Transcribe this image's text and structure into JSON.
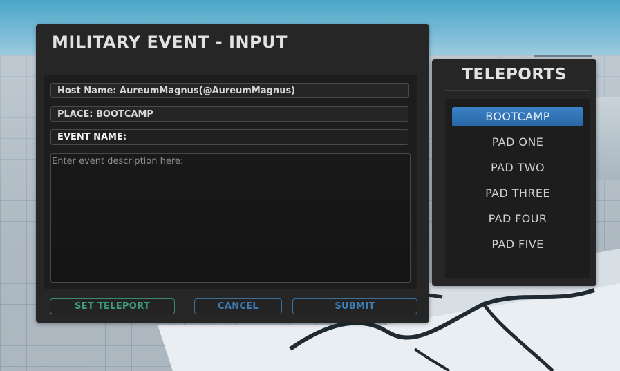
{
  "main_panel": {
    "title": "MILITARY EVENT - INPUT",
    "host_name": "Host Name: AureumMagnus(@AureumMagnus)",
    "place": "PLACE: BOOTCAMP",
    "event_name": "EVENT NAME:",
    "description_placeholder": "Enter event description here:",
    "buttons": {
      "set_teleport": "SET TELEPORT",
      "cancel": "CANCEL",
      "submit": "SUBMIT"
    }
  },
  "teleports": {
    "title": "TELEPORTS",
    "selected": "BOOTCAMP",
    "items": [
      {
        "label": "BOOTCAMP"
      },
      {
        "label": "PAD ONE"
      },
      {
        "label": "PAD TWO"
      },
      {
        "label": "PAD THREE"
      },
      {
        "label": "PAD FOUR"
      },
      {
        "label": "PAD FIVE"
      }
    ]
  },
  "colors": {
    "panel_bg": "#262626",
    "selected_item": "#2f74b8",
    "teleport_button": "#3f9c80",
    "action_button": "#3d7db3"
  }
}
